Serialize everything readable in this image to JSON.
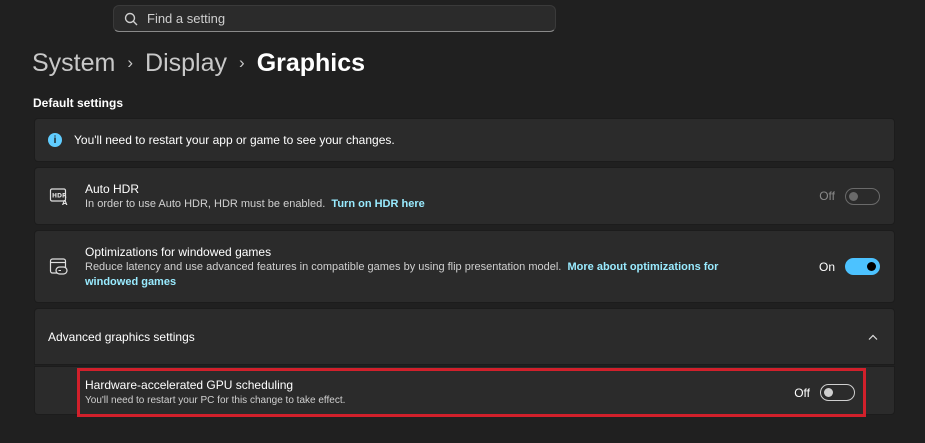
{
  "search": {
    "placeholder": "Find a setting"
  },
  "breadcrumb": {
    "items": [
      "System",
      "Display",
      "Graphics"
    ]
  },
  "default_settings": {
    "label": "Default settings"
  },
  "info_banner": {
    "text": "You'll need to restart your app or game to see your changes."
  },
  "auto_hdr": {
    "title": "Auto HDR",
    "description": "In order to use Auto HDR, HDR must be enabled.",
    "link": "Turn on HDR here",
    "state": "Off"
  },
  "windowed_games": {
    "title": "Optimizations for windowed games",
    "description": "Reduce latency and use advanced features in compatible games by using flip presentation model.",
    "link_part1": "More about optimizations for",
    "link_part2": "windowed games",
    "state": "On"
  },
  "advanced": {
    "title": "Advanced graphics settings"
  },
  "gpu_scheduling": {
    "title": "Hardware-accelerated GPU scheduling",
    "description": "You'll need to restart your PC for this change to take effect.",
    "state": "Off"
  },
  "colors": {
    "accent": "#4cc2ff",
    "highlight_border": "#d1202b",
    "link": "#99ebff"
  }
}
